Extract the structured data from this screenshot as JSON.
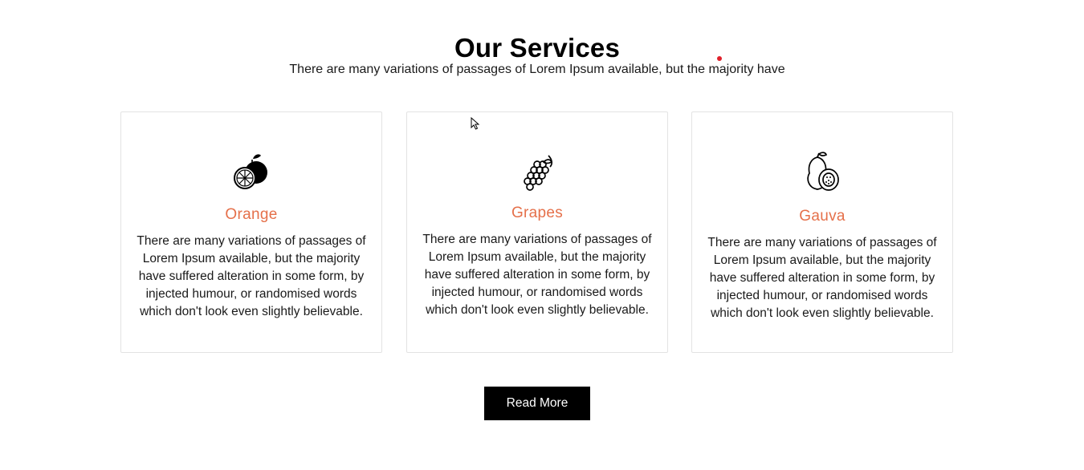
{
  "header": {
    "title": "Our Services",
    "subtitle": "There are many variations of passages of Lorem Ipsum available, but the majority have"
  },
  "services": [
    {
      "title": "Orange",
      "icon": "orange-icon",
      "text": "There are many variations of passages of Lorem Ipsum available, but the majority have suffered alteration in some form, by injected humour, or randomised words which don't look even slightly believable."
    },
    {
      "title": "Grapes",
      "icon": "grapes-icon",
      "text": "There are many variations of passages of Lorem Ipsum available, but the majority have suffered alteration in some form, by injected humour, or randomised words which don't look even slightly believable."
    },
    {
      "title": "Gauva",
      "icon": "guava-icon",
      "text": "There are many variations of passages of Lorem Ipsum available, but the majority have suffered alteration in some form, by injected humour, or randomised words which don't look even slightly believable."
    }
  ],
  "cta": {
    "label": "Read More"
  },
  "colors": {
    "accent": "#e5704a",
    "button_bg": "#000000",
    "button_text": "#ffffff",
    "card_border": "#e3e3e3"
  }
}
